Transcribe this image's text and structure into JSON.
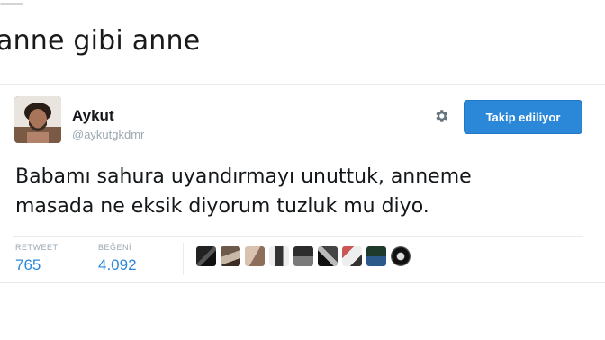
{
  "caption": "anne gibi anne",
  "tweet": {
    "author_name": "Aykut",
    "handle": "@aykutgkdmr",
    "follow_label": "Takip ediliyor",
    "text_line1": "Babamı sahura uyandırmayı unuttuk, anneme",
    "text_line2": "masada ne eksik diyorum tuzluk mu diyo.",
    "stats": {
      "retweet_label": "RETWEET",
      "retweet_count": "765",
      "like_label": "BEĞENİ",
      "like_count": "4.092"
    },
    "accent_color": "#2b88d8",
    "favoriters_shown": 10
  },
  "icons": {
    "settings": "gear-icon"
  }
}
